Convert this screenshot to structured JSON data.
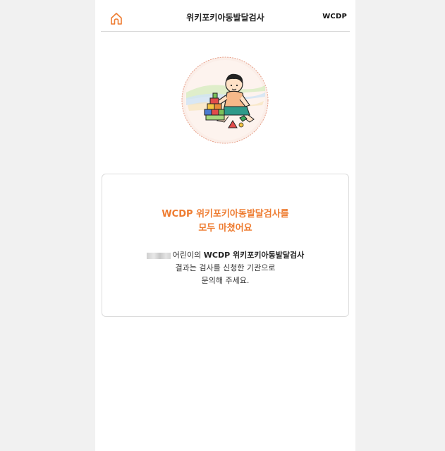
{
  "header": {
    "title": "위키포키아동발달검사",
    "brand": "WCDP",
    "home_icon": "home-icon"
  },
  "illustration": {
    "subject": "child-playing-with-blocks",
    "colors": {
      "circle_fill": "#fbeee8",
      "circle_border": "#e7a08a",
      "accent": "#ee7c31"
    }
  },
  "result_card": {
    "headline_line1": "WCDP 위키포키아동발달검사를",
    "headline_line2": "모두 마쳤어요",
    "line1_suffix": "어린이의",
    "line1_bold": "WCDP 위키포키아동발달검사",
    "line2": "결과는 검사를 신청한 기관으로",
    "line3": "문의해 주세요."
  },
  "colors": {
    "page_background": "#f1f1f1",
    "panel_background": "#ffffff",
    "accent_orange": "#ee7c31"
  }
}
